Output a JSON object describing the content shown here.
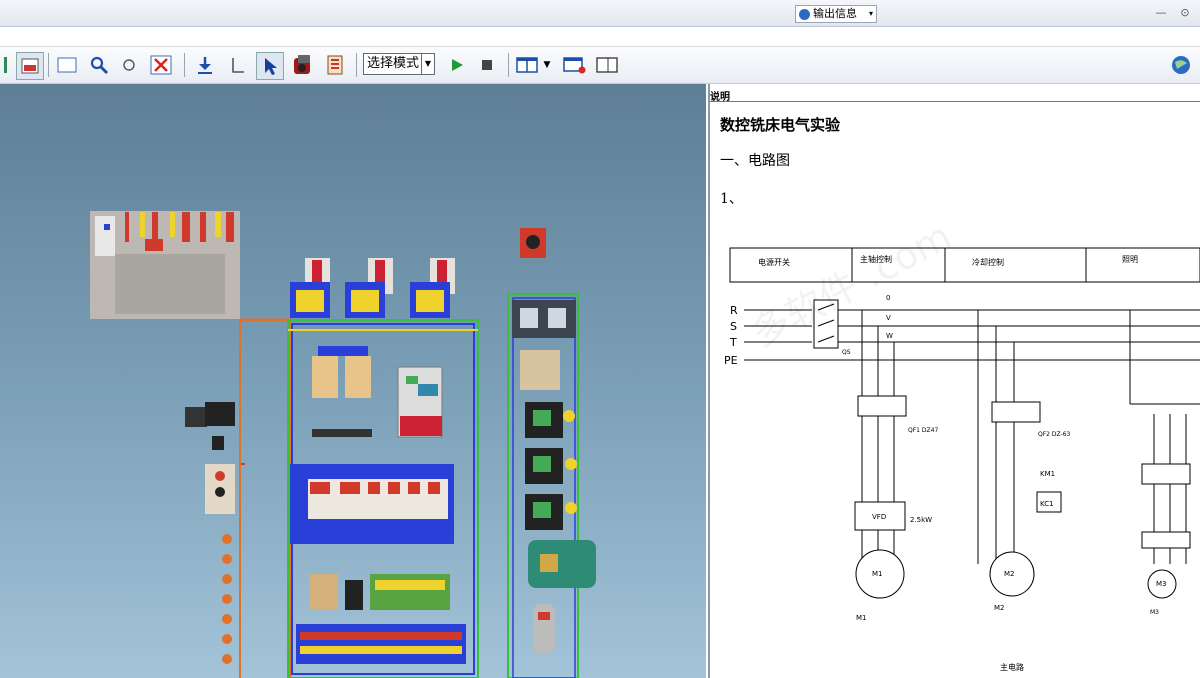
{
  "titlebar": {
    "dropdown_label": "输出信息",
    "min_symbol": "—",
    "restore_symbol": "⊙"
  },
  "toolbar": {
    "mode_select": "选择模式",
    "tools": [
      "panel-icon",
      "rect-select-icon",
      "zoom-icon",
      "rotate-icon",
      "delete-icon",
      "download-icon",
      "measure-icon",
      "pointer-icon",
      "record-icon",
      "document-icon",
      "play-icon",
      "stop-icon",
      "layout-icon",
      "split-icon",
      "window-icon",
      "globe-icon"
    ]
  },
  "document": {
    "label": "说明",
    "title": "数控铣床电气实验",
    "section": "一、电路图",
    "item_number": "1、",
    "watermark": "多软件  .com",
    "table_headers": [
      "电源开关",
      "主轴控制",
      "冷却控制",
      "照明"
    ],
    "rails": [
      "R",
      "S",
      "T",
      "PE"
    ],
    "component_labels": {
      "fu_top": "0",
      "fu_v": "V",
      "fu_w": "W",
      "pe_small": "QS",
      "qf1": "QF1 DZ47",
      "qf2": "QF2 DZ-63",
      "km1": "KM1",
      "vfd": "VFD",
      "vfd_note": "2.5kW",
      "kc1": "KC1",
      "m1": "M1",
      "m2": "M2",
      "m3": "M3",
      "m1_label": "M1",
      "m2_label": "M2",
      "m3_label": "M3",
      "bottom_note": "主电路"
    }
  },
  "colors": {
    "rail_red": "#d13a2b",
    "wire_blue": "#2a3fd8",
    "wire_green": "#34c23a",
    "wire_yellow": "#f0d22c",
    "wire_orange": "#e0712a",
    "accent": "#2c6bc4"
  }
}
